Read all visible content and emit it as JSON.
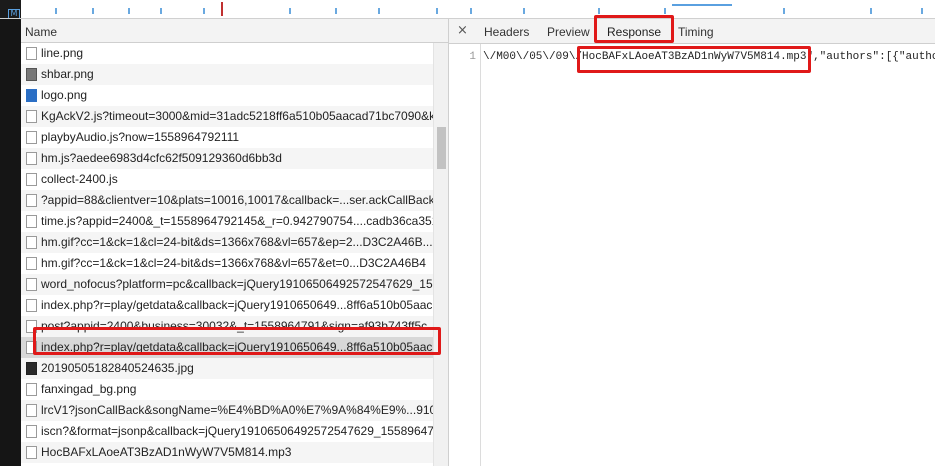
{
  "left_panel": {
    "column_header": "Name",
    "rows": [
      {
        "name": "line.png",
        "icon": "file-icon"
      },
      {
        "name": "shbar.png",
        "icon": "image-icon"
      },
      {
        "name": "logo.png",
        "icon": "logo-icon"
      },
      {
        "name": "KgAckV2.js?timeout=3000&mid=31adc5218ff6a510b05aacad71bc7090&k",
        "icon": "file-icon"
      },
      {
        "name": "playbyAudio.js?now=1558964792111",
        "icon": "file-icon"
      },
      {
        "name": "hm.js?aedee6983d4cfc62f509129360d6bb3d",
        "icon": "file-icon"
      },
      {
        "name": "collect-2400.js",
        "icon": "file-icon"
      },
      {
        "name": "?appid=88&clientver=10&plats=10016,10017&callback=...ser.ackCallBack",
        "icon": "file-icon"
      },
      {
        "name": "time.js?appid=2400&_t=1558964792145&_r=0.942790754....cadb36ca3517",
        "icon": "file-icon"
      },
      {
        "name": "hm.gif?cc=1&ck=1&cl=24-bit&ds=1366x768&vl=657&ep=2...D3C2A46B...",
        "icon": "file-icon"
      },
      {
        "name": "hm.gif?cc=1&ck=1&cl=24-bit&ds=1366x768&vl=657&et=0...D3C2A46B4",
        "icon": "file-icon"
      },
      {
        "name": "word_nofocus?platform=pc&callback=jQuery19106506492572547629_15...",
        "icon": "file-icon"
      },
      {
        "name": "index.php?r=play/getdata&callback=jQuery1910650649...8ff6a510b05aac",
        "icon": "file-icon"
      },
      {
        "name": "post?appid=2400&business=30032&_t=1558964791&sign=af93b743ff5c...",
        "icon": "file-icon"
      },
      {
        "name": "index.php?r=play/getdata&callback=jQuery1910650649...8ff6a510b05aac",
        "icon": "file-icon"
      },
      {
        "name": "20190505182840524635.jpg",
        "icon": "jpg-icon"
      },
      {
        "name": "fanxingad_bg.png",
        "icon": "file-icon"
      },
      {
        "name": "lrcV1?jsonCallBack&songName=%E4%BD%A0%E7%9A%84%E9%...910650",
        "icon": "file-icon"
      },
      {
        "name": "iscn?&format=jsonp&callback=jQuery19106506492572547629_15589647...",
        "icon": "file-icon"
      },
      {
        "name": "HocBAFxLAoeAT3BzAD1nWyW7V5M814.mp3",
        "icon": "file-icon"
      }
    ]
  },
  "right_panel": {
    "close_glyph": "×",
    "tabs": [
      "Headers",
      "Preview",
      "Response",
      "Timing"
    ],
    "active_tab": "Response",
    "line_number": "1",
    "code_before": "\\/M00\\/05\\/09\\/",
    "code_highlight": "HocBAFxLAoeAT3BzAD1nWyW7V5M814.mp3\"",
    "code_after": ",\"authors\":[{\"autho"
  },
  "timeline": {
    "badge": "M"
  },
  "colors": {
    "highlight": "#e01919",
    "accent": "#1a73e8",
    "selected_row": "#d8d8d8"
  }
}
